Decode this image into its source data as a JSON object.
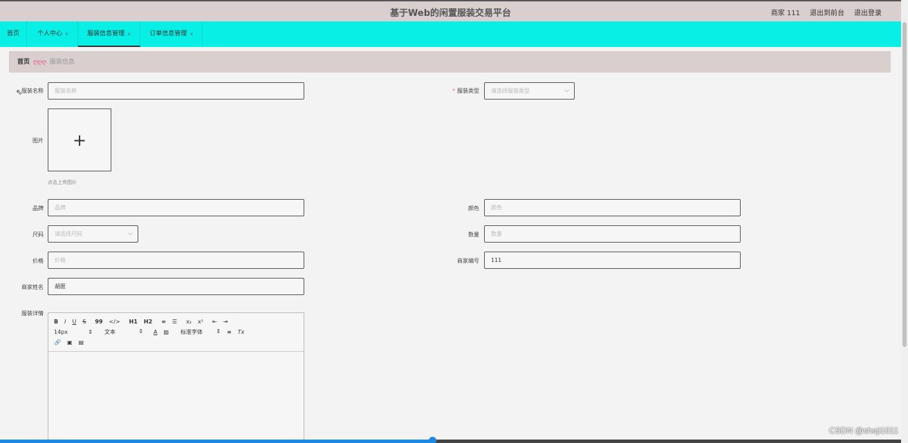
{
  "header": {
    "title": "基于Web的闲置服装交易平台",
    "user": "商家 111",
    "front_link": "退出到前台",
    "logout": "退出登录"
  },
  "nav": {
    "items": [
      {
        "label": "首页",
        "has_chevron": false
      },
      {
        "label": "个人中心",
        "has_chevron": true
      },
      {
        "label": "服装信息管理",
        "has_chevron": true
      },
      {
        "label": "订单信息管理",
        "has_chevron": true
      }
    ],
    "active": "服装信息管理"
  },
  "breadcrumb": {
    "home": "首页",
    "separator": "ღღღ",
    "current": "服装信息"
  },
  "form": {
    "name": {
      "label": "服装名称",
      "placeholder": "服装名称",
      "value": ""
    },
    "type": {
      "label": "服装类型",
      "placeholder": "请选择服装类型",
      "required": true
    },
    "image": {
      "label": "图片",
      "tip": "点击上传图片"
    },
    "brand": {
      "label": "品牌",
      "placeholder": "品牌"
    },
    "color": {
      "label": "颜色",
      "placeholder": "颜色"
    },
    "size": {
      "label": "尺码",
      "placeholder": "请选择尺码"
    },
    "quantity": {
      "label": "数量",
      "placeholder": "数量"
    },
    "price": {
      "label": "价格",
      "placeholder": "价格"
    },
    "merchant_no": {
      "label": "商家编号",
      "value": "111"
    },
    "merchant_name": {
      "label": "商家姓名",
      "value": "胡匪"
    },
    "detail": {
      "label": "服装详情"
    }
  },
  "editor": {
    "row1": [
      "B",
      "I",
      "U",
      "S",
      "99",
      "</>",
      "H1",
      "H2",
      "≡",
      "☰",
      "x₂",
      "x²",
      "⇤",
      "⇥"
    ],
    "font_size": "14px",
    "text_style": "文本",
    "font_family": "标准字体",
    "color_a": "A",
    "clear": "Tx"
  },
  "watermark": "CSDN @sheji1011",
  "video_progress": 0.48,
  "colors": {
    "navbar": "#08efe6",
    "topbar": "#d9cfcf",
    "required": "#f56c6c",
    "progress": "#1e88e5"
  }
}
